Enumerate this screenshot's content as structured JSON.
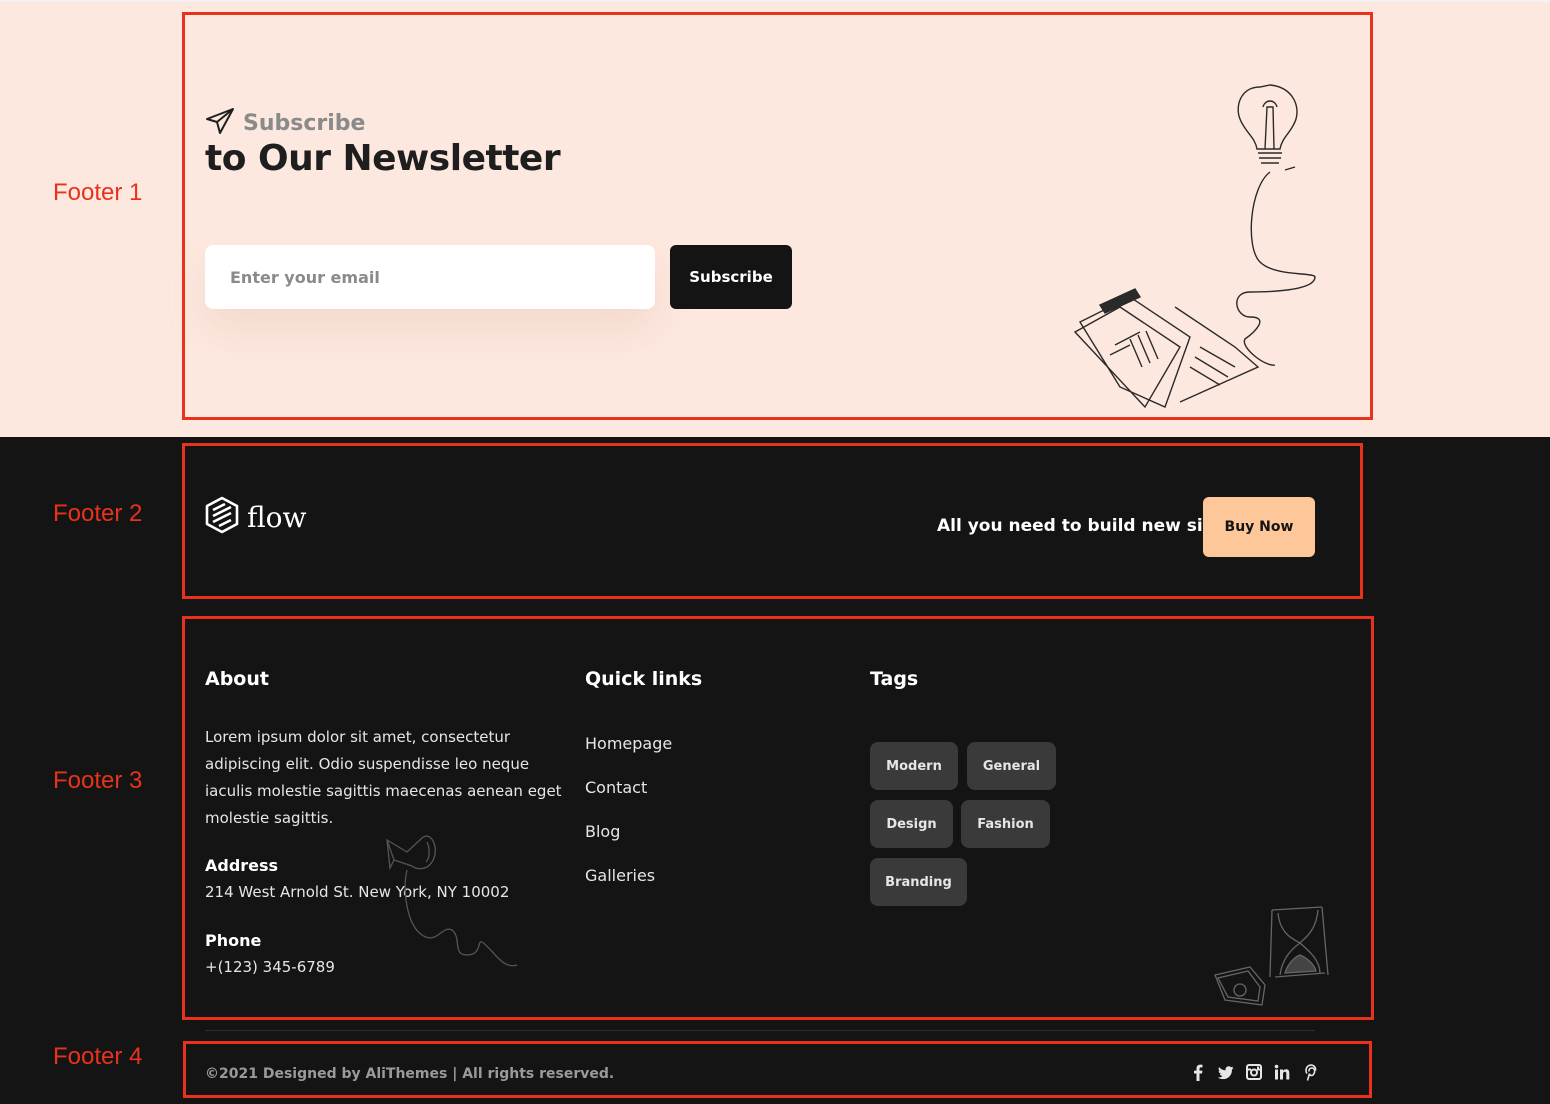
{
  "annotations": {
    "footer1_label": "Footer 1",
    "footer2_label": "Footer 2",
    "footer3_label": "Footer 3",
    "footer4_label": "Footer 4",
    "box_color": "#e8321c"
  },
  "newsletter": {
    "icon": "paper-plane-icon",
    "subtitle": "Subscribe",
    "title": "to Our Newsletter",
    "email_placeholder": "Enter your email",
    "email_value": "",
    "button_label": "Subscribe",
    "background": "#fde8df"
  },
  "brand": {
    "logo_icon": "flow-logo-icon",
    "logo_text": "flow",
    "tagline": "All you need to build new site",
    "buy_label": "Buy Now",
    "accent": "#fdc79a"
  },
  "about": {
    "title": "About",
    "text": "Lorem ipsum dolor sit amet, consectetur adipiscing elit. Odio suspendisse leo neque iaculis molestie sagittis maecenas aenean eget molestie sagittis.",
    "address_label": "Address",
    "address_value": "214 West Arnold St. New York, NY 10002",
    "phone_label": "Phone",
    "phone_value": "+(123) 345-6789"
  },
  "quick_links": {
    "title": "Quick links",
    "items": [
      "Homepage",
      "Contact",
      "Blog",
      "Galleries"
    ]
  },
  "tags": {
    "title": "Tags",
    "items": [
      "Modern",
      "General",
      "Design",
      "Fashion",
      "Branding"
    ]
  },
  "bottom": {
    "copyright": "©2021 Designed by AliThemes | All rights reserved.",
    "social_icons": [
      "facebook-icon",
      "twitter-icon",
      "instagram-icon",
      "linkedin-icon",
      "pinterest-icon"
    ]
  }
}
